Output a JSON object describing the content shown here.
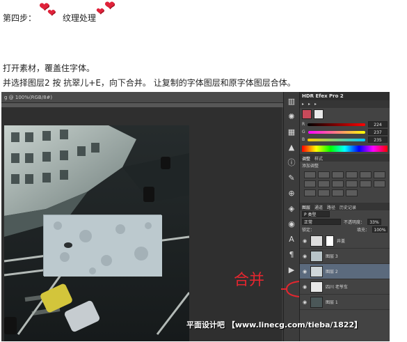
{
  "step": {
    "label": "第四步：",
    "title": "纹理处理"
  },
  "paragraphs": [
    "打开素材，覆盖住字体。",
    "并选择图层2 按 抗翠儿+E，向下合并。 让复制的字体图层和原字体图层合体。"
  ],
  "photoshop": {
    "doc_tab": "g @ 100%(RGB/8#)",
    "plugin_title": "HDR Efex Pro 2",
    "color_panel": {
      "rows": [
        {
          "label": "R",
          "value": "224"
        },
        {
          "label": "G",
          "value": "237"
        },
        {
          "label": "B",
          "value": "235"
        }
      ]
    },
    "adjustments": {
      "tabs": [
        "调整",
        "样式"
      ],
      "heading": "添加调整"
    },
    "layers_panel": {
      "tabs": [
        "图层",
        "通道",
        "路径",
        "历史记录"
      ],
      "kind": "P 类型",
      "blend_mode": "正常",
      "opacity_label": "不透明度：",
      "opacity_value": "33%",
      "lock_label": "锁定：",
      "fill_label": "填充：",
      "fill_value": "100%",
      "layers": [
        {
          "name": "井盖",
          "selected": false
        },
        {
          "name": "图层 3",
          "selected": false
        },
        {
          "name": "图层 2",
          "selected": true
        },
        {
          "name": "四川 老爷车",
          "selected": false
        },
        {
          "name": "图层 1",
          "selected": false
        }
      ]
    },
    "annotation": "合并",
    "watermark": "平面设计吧 【www.linecg.com/tieba/1822】"
  },
  "colors": {
    "heart": "#e0223a",
    "annotation": "#e4262f",
    "selected_layer": "#5b6a7d"
  }
}
